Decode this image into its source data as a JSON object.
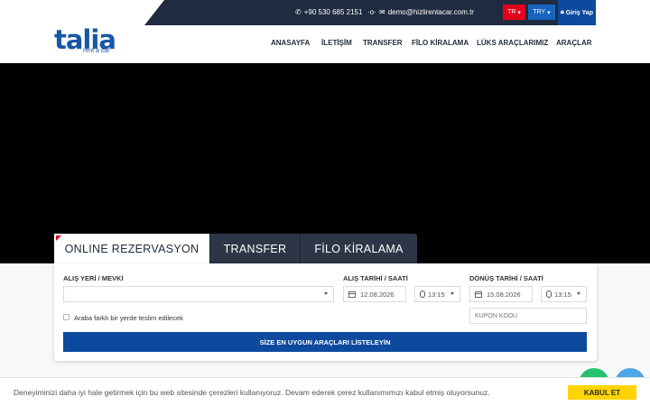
{
  "topbar": {
    "phone": "+90 530 685 2151",
    "email": "demo@hizlirentacar.com.tr",
    "language": "TR",
    "currency": "TRY",
    "login_label": "Giriş Yap"
  },
  "logo": {
    "main": "talia",
    "sub": "rent a car"
  },
  "nav": {
    "items": [
      "ANASAYFA",
      "İLETİŞİM",
      "TRANSFER",
      "FİLO KİRALAMA",
      "LÜKS ARAÇLARIMIZ",
      "ARAÇLAR"
    ]
  },
  "tabs": [
    "ONLINE REZERVASYON",
    "TRANSFER",
    "FİLO KİRALAMA"
  ],
  "form": {
    "pickup_location_label": "ALIŞ YERİ / MEVKİ",
    "pickup_date_label": "ALIŞ TARİHİ / SAATİ",
    "return_date_label": "DÖNÜŞ TARİHİ / SAATİ",
    "pickup_date": "12.08.2026",
    "pickup_time": "13:15",
    "return_date": "15.08.2026",
    "return_time": "13:15",
    "different_return_label": "Araba farklı bir yerde teslim edilecek",
    "coupon_placeholder": "KUPON KODU",
    "submit_label": "SİZE EN UYGUN ARAÇLARI LİSTELEYİN"
  },
  "cookie": {
    "text": "Deneyiminizi daha iyi hale getirmek için bu web sitesinde çerezleri kullanıyoruz. Devam ederek çerez kullanımımızı kabul etmiş oluyorsunuz.",
    "accept_label": "KABUL ET"
  },
  "colors": {
    "brand_blue": "#1657a8",
    "navy": "#1f2b3f",
    "accent_red": "#e3001b",
    "button_blue": "#0d4a9e",
    "cookie_yellow": "#ffd400"
  }
}
